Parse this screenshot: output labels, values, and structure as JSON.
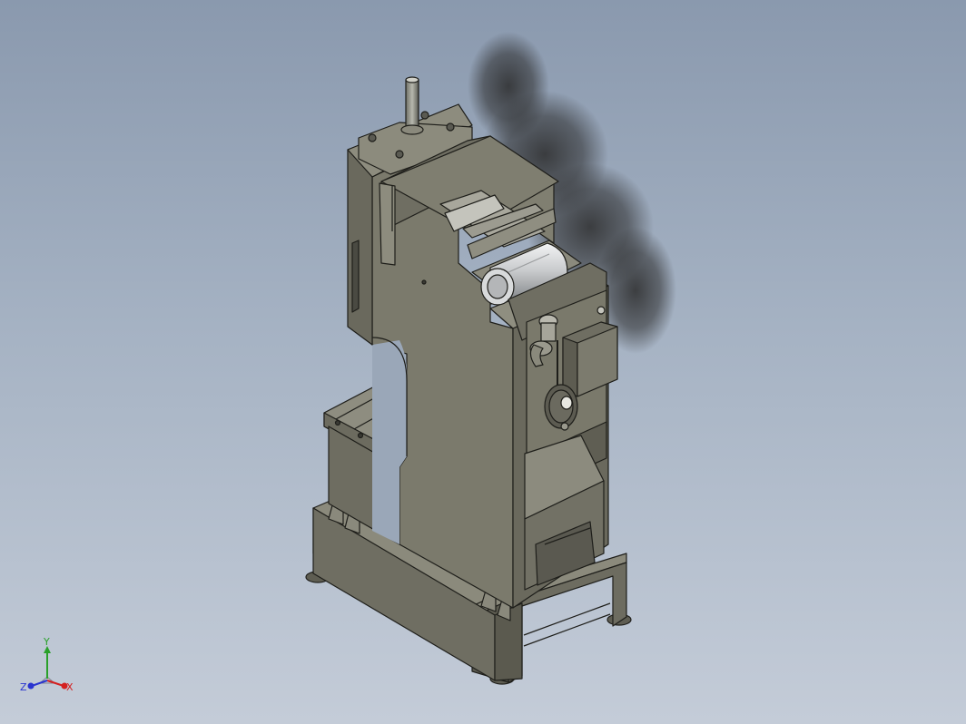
{
  "triad": {
    "y_label": "Y",
    "x_label": "X",
    "z_label": "Z",
    "colors": {
      "x": "#d42020",
      "y": "#2aa02a",
      "z": "#2a35d0"
    }
  },
  "scene": {
    "background_top": "#8a99ae",
    "background_bottom": "#c4ccd8",
    "machine_color": "#7a786a",
    "edge_color": "#1e1e1a",
    "motor_color": "#c8cacc"
  }
}
